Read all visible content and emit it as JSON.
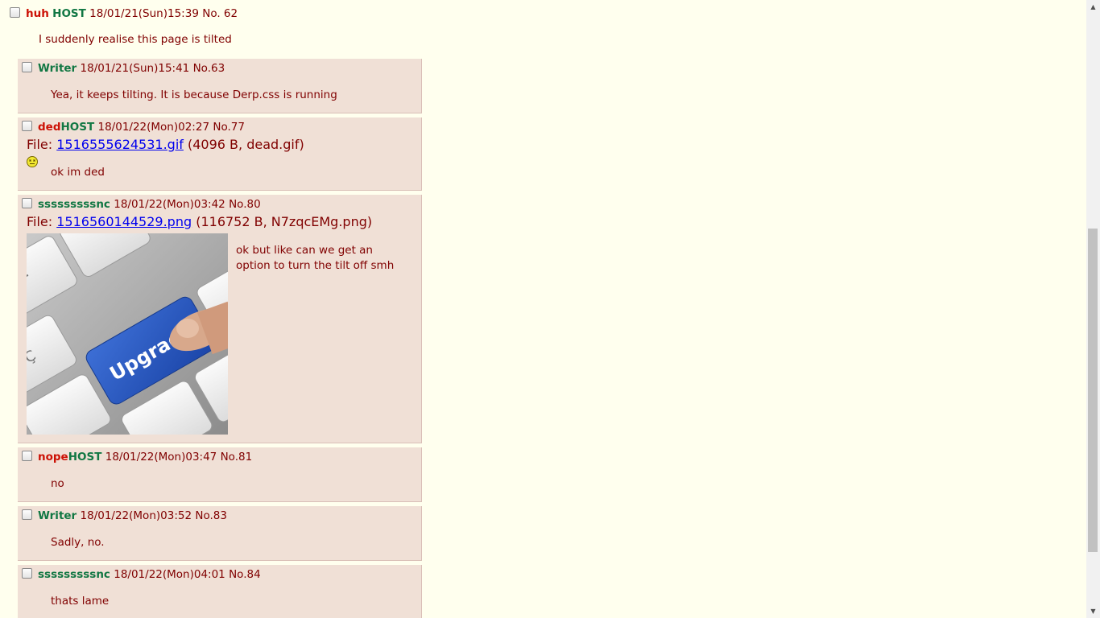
{
  "op": {
    "name": "huh",
    "trip": "HOST",
    "datetime": "18/01/21(Sun)15:39",
    "number": "No. 62",
    "message": "I suddenly realise this page is tilted"
  },
  "replies": [
    {
      "name": "",
      "trip": "Writer",
      "datetime": "18/01/21(Sun)15:41",
      "number": "No.63",
      "message": "Yea, it keeps tilting. It is because Derp.css is running"
    },
    {
      "name": "ded",
      "trip": "HOST",
      "datetime": "18/01/22(Mon)02:27",
      "number": "No.77",
      "file_label": "File: ",
      "file_link": "1516555624531.gif",
      "file_info": " (4096 B, dead.gif)",
      "message": "ok im ded"
    },
    {
      "name": "",
      "trip": "sssssssssnc",
      "datetime": "18/01/22(Mon)03:42",
      "number": "No.80",
      "file_label": "File: ",
      "file_link": "1516560144529.png",
      "file_info": " (116752 B, N7zqcEMg.png)",
      "message_line1": "ok but like can we get an",
      "message_line2": "option to turn the tilt off smh",
      "thumb_text": "Upgrade"
    },
    {
      "name": "nope",
      "trip": "HOST",
      "datetime": "18/01/22(Mon)03:47",
      "number": "No.81",
      "message": "no"
    },
    {
      "name": "",
      "trip": "Writer",
      "datetime": "18/01/22(Mon)03:52",
      "number": "No.83",
      "message": "Sadly, no."
    },
    {
      "name": "",
      "trip": "sssssssssnc",
      "datetime": "18/01/22(Mon)04:01",
      "number": "No.84",
      "message": "thats lame"
    }
  ]
}
